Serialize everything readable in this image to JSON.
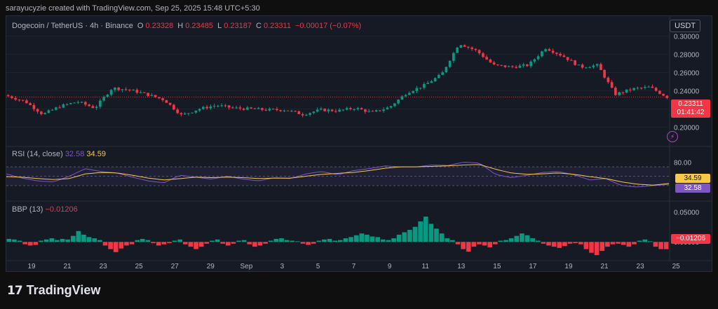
{
  "credit": "sarayucyzie created with TradingView.com, Sep 25, 2025 15:48 UTC+5:30",
  "legend": {
    "symbol": "Dogecoin / TetherUS · 4h · Binance",
    "o_label": "O",
    "o": "0.23328",
    "h_label": "H",
    "h": "0.23485",
    "l_label": "L",
    "l": "0.23187",
    "c_label": "C",
    "c": "0.23311",
    "change": "−0.00017 (−0.07%)"
  },
  "currency": "USDT",
  "price_tag": {
    "price": "0.23311",
    "countdown": "01:41:42"
  },
  "rsi": {
    "label": "RSI (14, close)",
    "value": "32.58",
    "ma": "34.59",
    "axis_labels": [
      "80.00"
    ]
  },
  "bbp": {
    "label": "BBP (13)",
    "value": "−0.01206",
    "axis_labels": [
      "0.05000",
      "0.00000"
    ]
  },
  "colors": {
    "up": "#089981",
    "down": "#f23645",
    "rsi": "#7e57c2",
    "rsi_ma": "#f7c948",
    "background": "#161a25"
  },
  "icons": {
    "alert": "bolt-icon",
    "logo": "tradingview-logo"
  },
  "footer": {
    "logo_mark": "17",
    "logo_text": "TradingView"
  },
  "chart_data": {
    "type": "candlestick",
    "price_axis": {
      "ylim": [
        0.185,
        0.305
      ],
      "ticks": [
        "0.30000",
        "0.28000",
        "0.26000",
        "0.24000",
        "0.22000",
        "0.20000"
      ]
    },
    "x_ticks": [
      "19",
      "21",
      "23",
      "25",
      "27",
      "29",
      "Sep",
      "3",
      "5",
      "7",
      "9",
      "11",
      "13",
      "15",
      "17",
      "19",
      "21",
      "23",
      "25"
    ],
    "price_path": [
      [
        0.235,
        0.234
      ],
      [
        0.225,
        0.228
      ],
      [
        0.212,
        0.214
      ],
      [
        0.22,
        0.223
      ],
      [
        0.224,
        0.228
      ],
      [
        0.219,
        0.221
      ],
      [
        0.24,
        0.243
      ],
      [
        0.239,
        0.241
      ],
      [
        0.237,
        0.236
      ],
      [
        0.232,
        0.23
      ],
      [
        0.216,
        0.213
      ],
      [
        0.218,
        0.22
      ],
      [
        0.222,
        0.224
      ],
      [
        0.222,
        0.221
      ],
      [
        0.219,
        0.22
      ],
      [
        0.217,
        0.219
      ],
      [
        0.22,
        0.219
      ],
      [
        0.216,
        0.214
      ],
      [
        0.217,
        0.219
      ],
      [
        0.22,
        0.218
      ],
      [
        0.222,
        0.221
      ],
      [
        0.218,
        0.216
      ],
      [
        0.22,
        0.222
      ],
      [
        0.236,
        0.238
      ],
      [
        0.244,
        0.246
      ],
      [
        0.256,
        0.258
      ],
      [
        0.281,
        0.292
      ],
      [
        0.286,
        0.284
      ],
      [
        0.265,
        0.268
      ],
      [
        0.266,
        0.266
      ],
      [
        0.266,
        0.268
      ],
      [
        0.283,
        0.287
      ],
      [
        0.277,
        0.278
      ],
      [
        0.266,
        0.266
      ],
      [
        0.267,
        0.268
      ],
      [
        0.251,
        0.236
      ],
      [
        0.241,
        0.242
      ],
      [
        0.239,
        0.244
      ],
      [
        0.233,
        0.233
      ]
    ],
    "rsi": {
      "ylim": [
        0,
        100
      ],
      "band": [
        30,
        70
      ],
      "rsi_path": [
        55,
        46,
        40,
        38,
        50,
        66,
        60,
        57,
        48,
        40,
        36,
        52,
        48,
        44,
        50,
        44,
        40,
        47,
        45,
        55,
        60,
        53,
        62,
        66,
        72,
        70,
        70,
        74,
        73,
        80,
        78,
        54,
        47,
        52,
        58,
        60,
        53,
        42,
        45,
        30,
        27,
        30,
        32.58
      ],
      "ma_path": [
        49,
        48,
        45,
        43,
        45,
        55,
        58,
        57,
        52,
        46,
        42,
        45,
        48,
        47,
        48,
        47,
        45,
        46,
        46,
        50,
        54,
        56,
        58,
        62,
        67,
        70,
        70,
        71,
        72,
        74,
        75,
        65,
        57,
        54,
        55,
        57,
        54,
        49,
        45,
        38,
        33,
        31,
        34.59
      ]
    },
    "bbp": {
      "ylim": [
        -0.03,
        0.055
      ],
      "values": [
        0.005,
        0.004,
        0.002,
        -0.004,
        -0.006,
        -0.005,
        0.002,
        0.004,
        0.006,
        0.003,
        0.005,
        0.004,
        0.01,
        0.018,
        0.012,
        0.008,
        0.006,
        0.003,
        -0.006,
        -0.012,
        -0.017,
        -0.011,
        -0.006,
        -0.004,
        0.003,
        0.005,
        0.003,
        -0.002,
        -0.006,
        -0.004,
        -0.002,
        0.002,
        0.004,
        -0.004,
        -0.008,
        -0.012,
        -0.008,
        -0.003,
        0.002,
        0.004,
        -0.003,
        -0.006,
        -0.003,
        0.002,
        0.003,
        -0.004,
        -0.008,
        -0.006,
        -0.003,
        0.002,
        0.005,
        0.006,
        0.003,
        0.002,
        0.001,
        -0.003,
        -0.005,
        -0.003,
        0.002,
        0.004,
        0.005,
        0.002,
        0.003,
        0.006,
        0.008,
        0.011,
        0.014,
        0.012,
        0.009,
        0.008,
        0.004,
        0.003,
        0.006,
        0.012,
        0.016,
        0.02,
        0.025,
        0.034,
        0.042,
        0.03,
        0.022,
        0.014,
        0.006,
        0.003,
        -0.004,
        -0.012,
        -0.016,
        -0.008,
        -0.004,
        -0.006,
        -0.009,
        -0.004,
        0.002,
        0.003,
        0.006,
        0.01,
        0.014,
        0.011,
        0.006,
        0.002,
        -0.003,
        -0.006,
        -0.008,
        -0.01,
        -0.007,
        -0.003,
        -0.002,
        -0.004,
        -0.012,
        -0.018,
        -0.022,
        -0.015,
        -0.008,
        -0.004,
        -0.003,
        -0.005,
        -0.008,
        -0.004,
        0.002,
        0.004,
        0.001,
        -0.008,
        -0.012,
        -0.01206
      ]
    }
  }
}
